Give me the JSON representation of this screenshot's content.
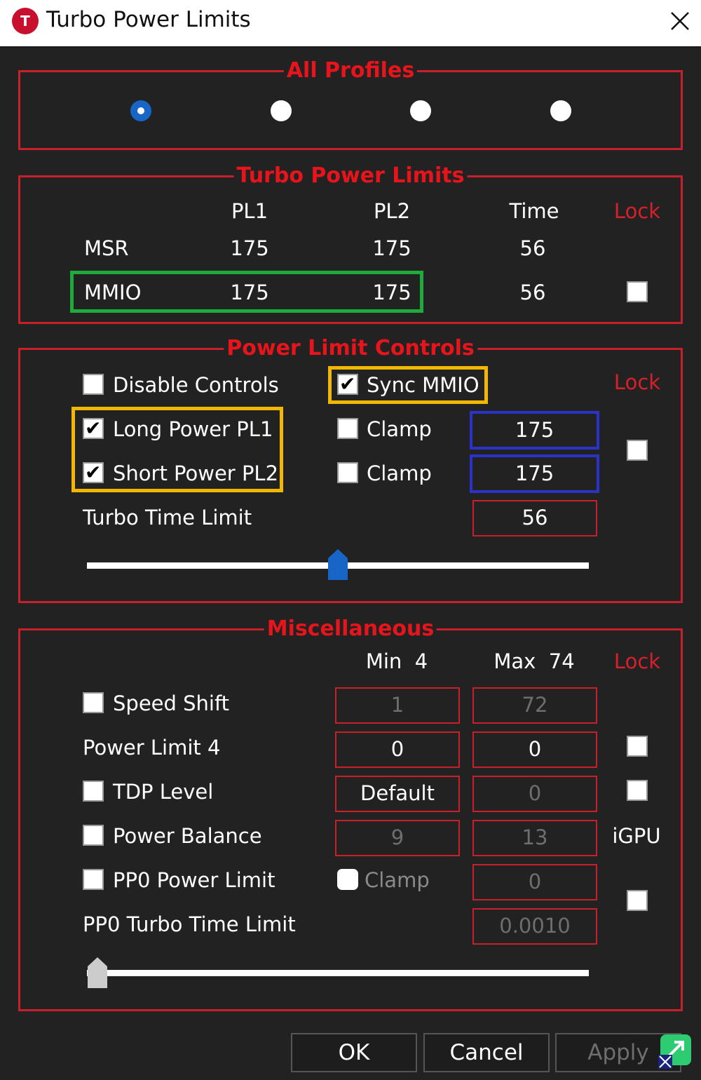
{
  "window": {
    "title": "Turbo Power Limits",
    "app_icon_letter": "T"
  },
  "all_profiles": {
    "legend": "All Profiles",
    "selected_index": 0
  },
  "turbo_power_limits": {
    "legend": "Turbo Power Limits",
    "headers": {
      "pl1": "PL1",
      "pl2": "PL2",
      "time": "Time",
      "lock": "Lock"
    },
    "msr": {
      "label": "MSR",
      "pl1": "175",
      "pl2": "175",
      "time": "56"
    },
    "mmio": {
      "label": "MMIO",
      "pl1": "175",
      "pl2": "175",
      "time": "56",
      "lock_checked": false
    }
  },
  "power_limit_controls": {
    "legend": "Power Limit Controls",
    "lock_label": "Lock",
    "disable_controls": {
      "label": "Disable Controls",
      "checked": false
    },
    "sync_mmio": {
      "label": "Sync MMIO",
      "checked": true
    },
    "long_power": {
      "label": "Long Power PL1",
      "checked": true,
      "clamp_label": "Clamp",
      "clamp_checked": false,
      "value": "175"
    },
    "short_power": {
      "label": "Short Power PL2",
      "checked": true,
      "clamp_label": "Clamp",
      "clamp_checked": false,
      "value": "175"
    },
    "turbo_time_limit": {
      "label": "Turbo Time Limit",
      "value": "56",
      "slider_fraction": 0.5
    },
    "lock_checked": false
  },
  "miscellaneous": {
    "legend": "Miscellaneous",
    "min_label": "Min  4",
    "max_label": "Max  74",
    "lock_label": "Lock",
    "speed_shift": {
      "label": "Speed Shift",
      "checked": false,
      "min": "1",
      "max": "72"
    },
    "power_limit_4": {
      "label": "Power Limit 4",
      "min": "0",
      "max": "0",
      "lock_checked": false
    },
    "tdp_level": {
      "label": "TDP Level",
      "checked": false,
      "min": "Default",
      "max": "0",
      "lock_checked": false
    },
    "power_balance": {
      "label": "Power Balance",
      "checked": false,
      "min": "9",
      "max": "13",
      "side_label": "iGPU"
    },
    "pp0_power_limit": {
      "label": "PP0 Power Limit",
      "checked": false,
      "clamp_label": "Clamp",
      "clamp_checked": false,
      "value": "0"
    },
    "pp0_turbo_time_limit": {
      "label": "PP0 Turbo Time Limit",
      "value": "0.0010",
      "slider_fraction": 0.0
    },
    "pp0_lock_checked": false
  },
  "buttons": {
    "ok": "OK",
    "cancel": "Cancel",
    "apply": "Apply"
  },
  "colors": {
    "group_border": "#c8202a",
    "legend": "#e8141c",
    "accent_blue": "#1766c7",
    "highlight_green": "#1faa3c",
    "highlight_yellow": "#f2b705",
    "highlight_blue": "#2a32c8"
  }
}
